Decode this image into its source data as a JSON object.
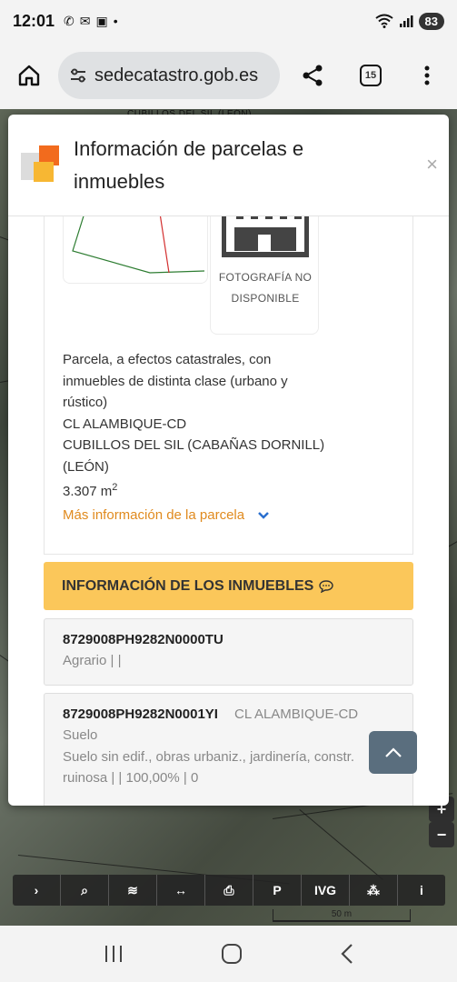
{
  "status_bar": {
    "time": "12:01",
    "battery": "83"
  },
  "browser": {
    "url": "sedecatastro.gob.es",
    "tab_count": "15"
  },
  "map": {
    "street_label": "CUBILLOS DEL SIL (LEÓN)",
    "scale_label": "50 m",
    "tools": [
      "›",
      "⌕",
      "≋",
      "↔",
      "⎙",
      "P",
      "IVG",
      "⁂",
      "i"
    ],
    "zoom_plus": "+",
    "zoom_minus": "−"
  },
  "modal": {
    "title": "Información de parcelas e inmuebles",
    "close": "×",
    "photo_text": "FOTOGRAFÍA NO DISPONIBLE",
    "parcel": {
      "line1": "Parcela, a efectos catastrales, con",
      "line2": "inmuebles de distinta clase (urbano y",
      "line3": "rústico)",
      "address": "CL ALAMBIQUE-CD",
      "municipality": "CUBILLOS DEL SIL (CABAÑAS DORNILL)",
      "province": "(LEÓN)",
      "area_value": "3.307 m",
      "area_exp": "2"
    },
    "more_info_label": "Más información de la parcela",
    "inmuebles_header": "INFORMACIÓN DE LOS INMUEBLES",
    "inmuebles": [
      {
        "ref": "8729008PH9282N0000TU",
        "address": "",
        "line1": "Agrario | |",
        "line2": "",
        "line3": ""
      },
      {
        "ref": "8729008PH9282N0001YI",
        "address": "CL ALAMBIQUE-CD",
        "line1": "Suelo",
        "line2": "Suelo sin edif., obras urbaniz., jardinería, constr.",
        "line3": "ruinosa | | 100,00% | 0"
      }
    ]
  }
}
